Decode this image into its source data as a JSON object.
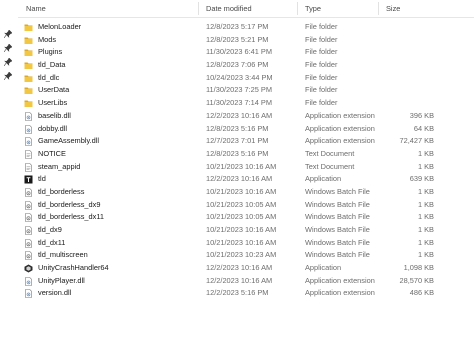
{
  "columns": {
    "name": "Name",
    "date": "Date modified",
    "type": "Type",
    "size": "Size"
  },
  "files": [
    {
      "name": "MelonLoader",
      "date": "12/8/2023 5:17 PM",
      "type": "File folder",
      "size": "",
      "icon": "folder-icon"
    },
    {
      "name": "Mods",
      "date": "12/8/2023 5:21 PM",
      "type": "File folder",
      "size": "",
      "icon": "folder-icon"
    },
    {
      "name": "Plugins",
      "date": "11/30/2023 6:41 PM",
      "type": "File folder",
      "size": "",
      "icon": "folder-icon"
    },
    {
      "name": "tld_Data",
      "date": "12/8/2023 7:06 PM",
      "type": "File folder",
      "size": "",
      "icon": "folder-icon"
    },
    {
      "name": "tld_dlc",
      "date": "10/24/2023 3:44 PM",
      "type": "File folder",
      "size": "",
      "icon": "folder-icon"
    },
    {
      "name": "UserData",
      "date": "11/30/2023 7:25 PM",
      "type": "File folder",
      "size": "",
      "icon": "folder-icon"
    },
    {
      "name": "UserLibs",
      "date": "11/30/2023 7:14 PM",
      "type": "File folder",
      "size": "",
      "icon": "folder-icon"
    },
    {
      "name": "baselib.dll",
      "date": "12/2/2023 10:16 AM",
      "type": "Application extension",
      "size": "396 KB",
      "icon": "dll-icon"
    },
    {
      "name": "dobby.dll",
      "date": "12/8/2023 5:16 PM",
      "type": "Application extension",
      "size": "64 KB",
      "icon": "dll-icon"
    },
    {
      "name": "GameAssembly.dll",
      "date": "12/7/2023 7:01 PM",
      "type": "Application extension",
      "size": "72,427 KB",
      "icon": "dll-icon"
    },
    {
      "name": "NOTICE",
      "date": "12/8/2023 5:16 PM",
      "type": "Text Document",
      "size": "1 KB",
      "icon": "text-file-icon"
    },
    {
      "name": "steam_appid",
      "date": "10/21/2023 10:16 AM",
      "type": "Text Document",
      "size": "1 KB",
      "icon": "text-file-icon"
    },
    {
      "name": "tld",
      "date": "12/2/2023 10:16 AM",
      "type": "Application",
      "size": "639 KB",
      "icon": "app-icon"
    },
    {
      "name": "tld_borderless",
      "date": "10/21/2023 10:16 AM",
      "type": "Windows Batch File",
      "size": "1 KB",
      "icon": "batch-file-icon"
    },
    {
      "name": "tld_borderless_dx9",
      "date": "10/21/2023 10:05 AM",
      "type": "Windows Batch File",
      "size": "1 KB",
      "icon": "batch-file-icon"
    },
    {
      "name": "tld_borderless_dx11",
      "date": "10/21/2023 10:05 AM",
      "type": "Windows Batch File",
      "size": "1 KB",
      "icon": "batch-file-icon"
    },
    {
      "name": "tld_dx9",
      "date": "10/21/2023 10:16 AM",
      "type": "Windows Batch File",
      "size": "1 KB",
      "icon": "batch-file-icon"
    },
    {
      "name": "tld_dx11",
      "date": "10/21/2023 10:16 AM",
      "type": "Windows Batch File",
      "size": "1 KB",
      "icon": "batch-file-icon"
    },
    {
      "name": "tld_multiscreen",
      "date": "10/21/2023 10:23 AM",
      "type": "Windows Batch File",
      "size": "1 KB",
      "icon": "batch-file-icon"
    },
    {
      "name": "UnityCrashHandler64",
      "date": "12/2/2023 10:16 AM",
      "type": "Application",
      "size": "1,098 KB",
      "icon": "crash-handler-icon"
    },
    {
      "name": "UnityPlayer.dll",
      "date": "12/2/2023 10:16 AM",
      "type": "Application extension",
      "size": "28,570 KB",
      "icon": "dll-icon"
    },
    {
      "name": "version.dll",
      "date": "12/2/2023 5:16 PM",
      "type": "Application extension",
      "size": "486 KB",
      "icon": "dll-icon"
    }
  ],
  "sidebar_pins": [
    "pin-icon",
    "pin-icon",
    "pin-icon",
    "pin-icon"
  ],
  "colors": {
    "folder": "#f2c744",
    "folder_tab": "#dca926",
    "header_text": "#4a4a4a",
    "secondary_text": "#6d6d6d"
  }
}
